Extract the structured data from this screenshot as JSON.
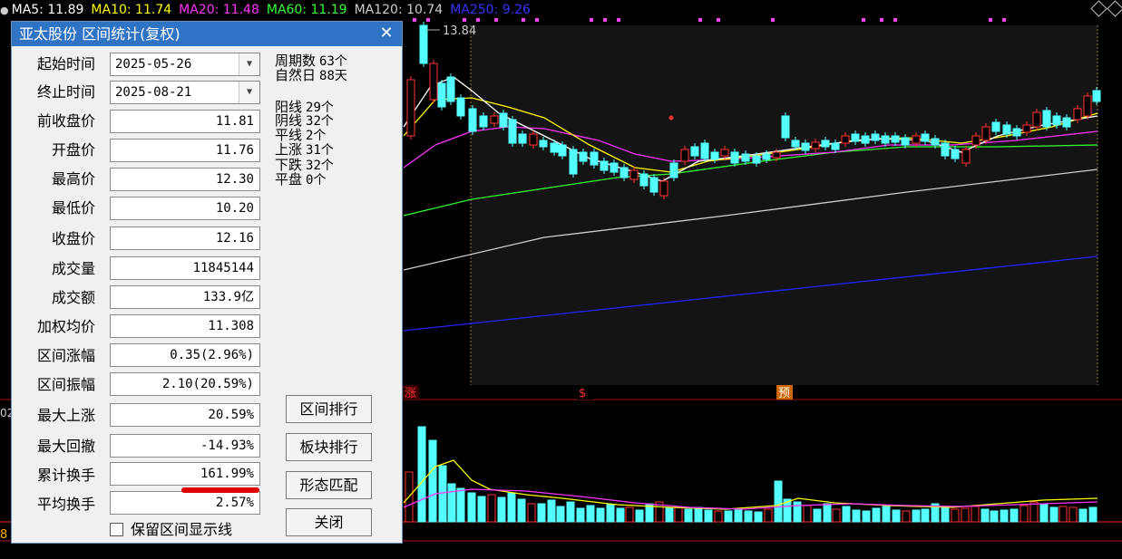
{
  "ma_bar": {
    "ma5": {
      "label": "MA5: 11.89",
      "color": "#ffffff"
    },
    "ma10": {
      "label": "MA10: 11.74",
      "color": "#ffff00"
    },
    "ma20": {
      "label": "MA20: 11.48",
      "color": "#ff33ff"
    },
    "ma60": {
      "label": "MA60: 11.19",
      "color": "#33ff33"
    },
    "ma120": {
      "label": "MA120: 10.74",
      "color": "#cccccc"
    },
    "ma250": {
      "label": "MA250: 9.26",
      "color": "#3333ff"
    }
  },
  "chart": {
    "high_label": "13.84",
    "markers": [
      "涨",
      "$",
      "预"
    ],
    "left_edge_label": "8",
    "volume_edge_label": "02"
  },
  "dialog": {
    "title": "亚太股份 区间统计(复权)",
    "close_label": "✕",
    "start_label": "起始时间",
    "start_value": "2025-05-26",
    "end_label": "终止时间",
    "end_value": "2025-08-21",
    "fields": [
      {
        "label": "前收盘价",
        "value": "11.81"
      },
      {
        "label": "开盘价",
        "value": "11.76"
      },
      {
        "label": "最高价",
        "value": "12.30"
      },
      {
        "label": "最低价",
        "value": "10.20"
      },
      {
        "label": "收盘价",
        "value": "12.16"
      },
      {
        "label": "成交量",
        "value": "11845144"
      },
      {
        "label": "成交额",
        "value": "133.9亿"
      },
      {
        "label": "加权均价",
        "value": "11.308"
      },
      {
        "label": "区间涨幅",
        "value": "0.35(2.96%)"
      },
      {
        "label": "区间振幅",
        "value": "2.10(20.59%)"
      },
      {
        "label": "最大上涨",
        "value": "20.59%"
      },
      {
        "label": "最大回撤",
        "value": "-14.93%"
      },
      {
        "label": "累计换手",
        "value": "161.99%"
      },
      {
        "label": "平均换手",
        "value": "2.57%"
      }
    ],
    "stats": [
      {
        "label": "周期数",
        "value": "63个"
      },
      {
        "label": "自然日",
        "value": "88天"
      },
      {
        "label": "阳线",
        "value": "29个"
      },
      {
        "label": "阴线",
        "value": "32个"
      },
      {
        "label": "平线",
        "value": "2个"
      },
      {
        "label": "上涨",
        "value": "31个"
      },
      {
        "label": "下跌",
        "value": "32个"
      },
      {
        "label": "平盘",
        "value": "0个"
      }
    ],
    "buttons": {
      "rank": "区间排行",
      "sector": "板块排行",
      "pattern": "形态匹配",
      "close": "关闭"
    },
    "keep_lines_label": "保留区间显示线"
  },
  "colors": {
    "up": "#ff3232",
    "down": "#54ffff",
    "bg": "#000000",
    "dialog_title": "#2f73c4"
  }
}
